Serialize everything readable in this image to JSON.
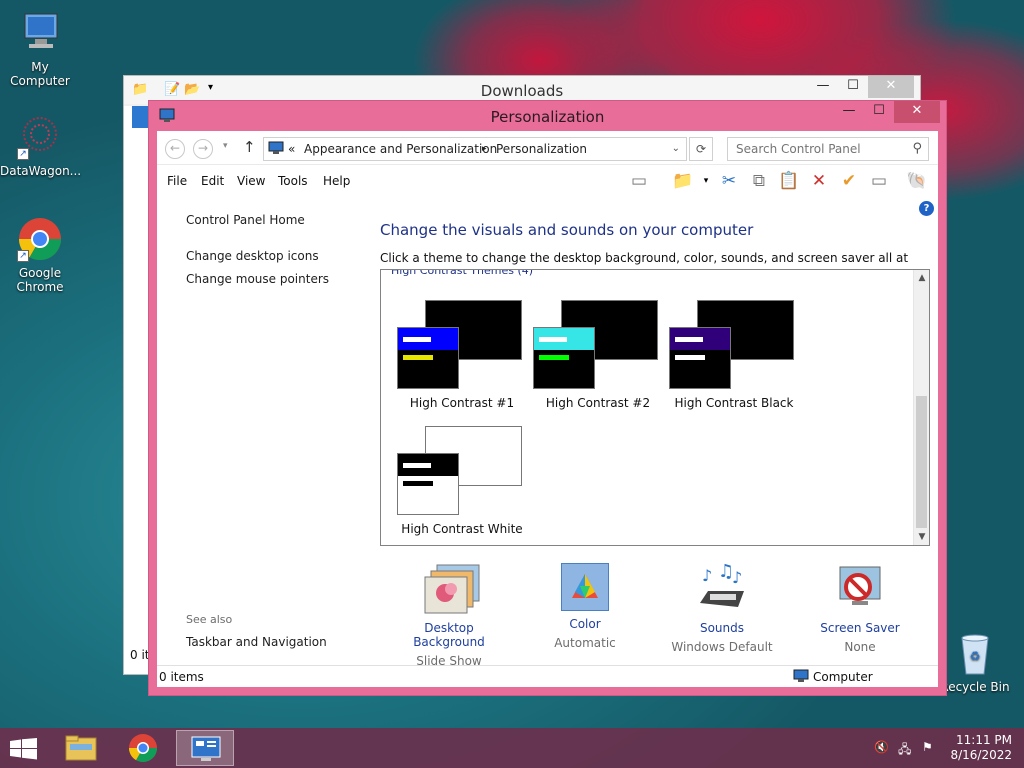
{
  "desktop": {
    "icons": [
      {
        "label": "My Computer"
      },
      {
        "label": "DataWagon..."
      },
      {
        "label": "Google Chrome"
      },
      {
        "label": "Recycle Bin"
      }
    ]
  },
  "downloads_window": {
    "title": "Downloads",
    "status_items": "0 it"
  },
  "window": {
    "title": "Personalization",
    "minimize": "—",
    "maximize": "☐",
    "close": "✕"
  },
  "address": {
    "prefix": "«",
    "crumb1": "Appearance and Personalization",
    "separator": "▸",
    "crumb2": "Personalization",
    "search_placeholder": "Search Control Panel"
  },
  "menu": {
    "file": "File",
    "edit": "Edit",
    "view": "View",
    "tools": "Tools",
    "help": "Help"
  },
  "sidebar": {
    "home": "Control Panel Home",
    "desktop_icons": "Change desktop icons",
    "mouse_pointers": "Change mouse pointers",
    "see_also": "See also",
    "taskbar_nav": "Taskbar and Navigation"
  },
  "main": {
    "heading": "Change the visuals and sounds on your computer",
    "subtitle": "Click a theme to change the desktop background, color, sounds, and screen saver all at once.",
    "group_header": "High Contrast Themes (4)",
    "themes": [
      {
        "name": "High Contrast #1",
        "hdr": "#0000ff",
        "bar1": "#ffffff",
        "bar2": "#e6e600",
        "bg": "#000000",
        "back": "#000000"
      },
      {
        "name": "High Contrast #2",
        "hdr": "#36e6e6",
        "bar1": "#ffffff",
        "bar2": "#00ff00",
        "bg": "#000000",
        "back": "#000000"
      },
      {
        "name": "High Contrast Black",
        "hdr": "#30007a",
        "bar1": "#ffffff",
        "bar2": "#ffffff",
        "bg": "#000000",
        "back": "#000000"
      },
      {
        "name": "High Contrast White",
        "hdr": "#000000",
        "bar1": "#ffffff",
        "bar2": "#000000",
        "bg": "#ffffff",
        "back": "#ffffff"
      }
    ]
  },
  "bottom": {
    "desktop_background": {
      "label": "Desktop Background",
      "value": "Slide Show"
    },
    "color": {
      "label": "Color",
      "value": "Automatic"
    },
    "sounds": {
      "label": "Sounds",
      "value": "Windows Default"
    },
    "screen_saver": {
      "label": "Screen Saver",
      "value": "None"
    }
  },
  "status": {
    "items": "0 items",
    "location": "Computer"
  },
  "taskbar": {
    "time": "11:11 PM",
    "date": "8/16/2022"
  },
  "colors": {
    "window_frame": "#e86d98",
    "link": "#1e3f9e",
    "heading": "#1e3287"
  }
}
